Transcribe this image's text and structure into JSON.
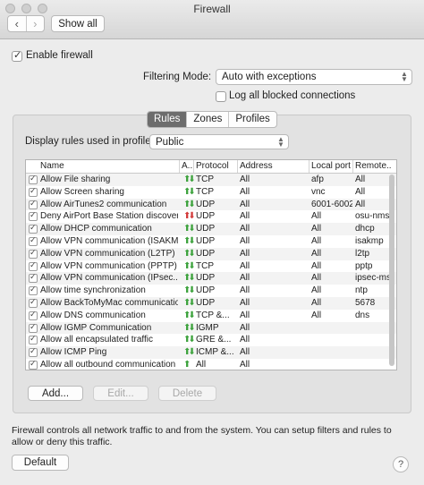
{
  "window": {
    "title": "Firewall"
  },
  "toolbar": {
    "back_glyph": "‹",
    "forward_glyph": "›",
    "show_all_label": "Show all"
  },
  "enable_firewall": {
    "label": "Enable firewall",
    "checked": true
  },
  "filtering_mode": {
    "label": "Filtering Mode:",
    "value": "Auto with exceptions"
  },
  "log_blocked": {
    "label": "Log all blocked connections",
    "checked": false
  },
  "tabs": [
    {
      "label": "Rules",
      "active": true
    },
    {
      "label": "Zones",
      "active": false
    },
    {
      "label": "Profiles",
      "active": false
    }
  ],
  "profile": {
    "label": "Display rules used in profile:",
    "value": "Public"
  },
  "table": {
    "headers": {
      "name": "Name",
      "action": "A...",
      "protocol": "Protocol",
      "address": "Address",
      "local_port": "Local port",
      "remote": "Remote..."
    },
    "rows": [
      {
        "name": "Allow File sharing",
        "dir": "both",
        "protocol": "TCP",
        "address": "All",
        "local_port": "afp",
        "remote": "All"
      },
      {
        "name": "Allow Screen sharing",
        "dir": "both",
        "protocol": "TCP",
        "address": "All",
        "local_port": "vnc",
        "remote": "All"
      },
      {
        "name": "Allow AirTunes2 communication",
        "dir": "both",
        "protocol": "UDP",
        "address": "All",
        "local_port": "6001-6002",
        "remote": "All"
      },
      {
        "name": "Deny AirPort Base Station discovery",
        "dir": "deny",
        "protocol": "UDP",
        "address": "All",
        "local_port": "All",
        "remote": "osu-nms"
      },
      {
        "name": "Allow DHCP communication",
        "dir": "both",
        "protocol": "UDP",
        "address": "All",
        "local_port": "All",
        "remote": "dhcp"
      },
      {
        "name": "Allow VPN communication (ISAKM...",
        "dir": "both",
        "protocol": "UDP",
        "address": "All",
        "local_port": "All",
        "remote": "isakmp"
      },
      {
        "name": "Allow VPN communication (L2TP)",
        "dir": "both",
        "protocol": "UDP",
        "address": "All",
        "local_port": "All",
        "remote": "l2tp"
      },
      {
        "name": "Allow VPN communication (PPTP)",
        "dir": "both",
        "protocol": "TCP",
        "address": "All",
        "local_port": "All",
        "remote": "pptp"
      },
      {
        "name": "Allow VPN communication (IPsec...",
        "dir": "both",
        "protocol": "UDP",
        "address": "All",
        "local_port": "All",
        "remote": "ipsec-ms"
      },
      {
        "name": "Allow time synchronization",
        "dir": "both",
        "protocol": "UDP",
        "address": "All",
        "local_port": "All",
        "remote": "ntp"
      },
      {
        "name": "Allow BackToMyMac communication",
        "dir": "both",
        "protocol": "UDP",
        "address": "All",
        "local_port": "All",
        "remote": "5678"
      },
      {
        "name": "Allow DNS communication",
        "dir": "both",
        "protocol": "TCP &...",
        "address": "All",
        "local_port": "All",
        "remote": "dns"
      },
      {
        "name": "Allow IGMP Communication",
        "dir": "both",
        "protocol": "IGMP",
        "address": "All",
        "local_port": "",
        "remote": ""
      },
      {
        "name": "Allow all encapsulated traffic",
        "dir": "both",
        "protocol": "GRE &...",
        "address": "All",
        "local_port": "",
        "remote": ""
      },
      {
        "name": "Allow ICMP Ping",
        "dir": "both",
        "protocol": "ICMP &...",
        "address": "All",
        "local_port": "",
        "remote": ""
      },
      {
        "name": "Allow all outbound communication",
        "dir": "out",
        "protocol": "All",
        "address": "All",
        "local_port": "",
        "remote": ""
      }
    ]
  },
  "buttons": {
    "add": "Add...",
    "edit": "Edit...",
    "delete": "Delete",
    "default": "Default",
    "help": "?"
  },
  "description": "Firewall controls all network traffic to and from the system. You can setup filters and rules to allow or deny this traffic.",
  "colors": {
    "allow": "#3ca23c",
    "deny": "#d23a3a",
    "active_tab": "#6d6d6d"
  }
}
